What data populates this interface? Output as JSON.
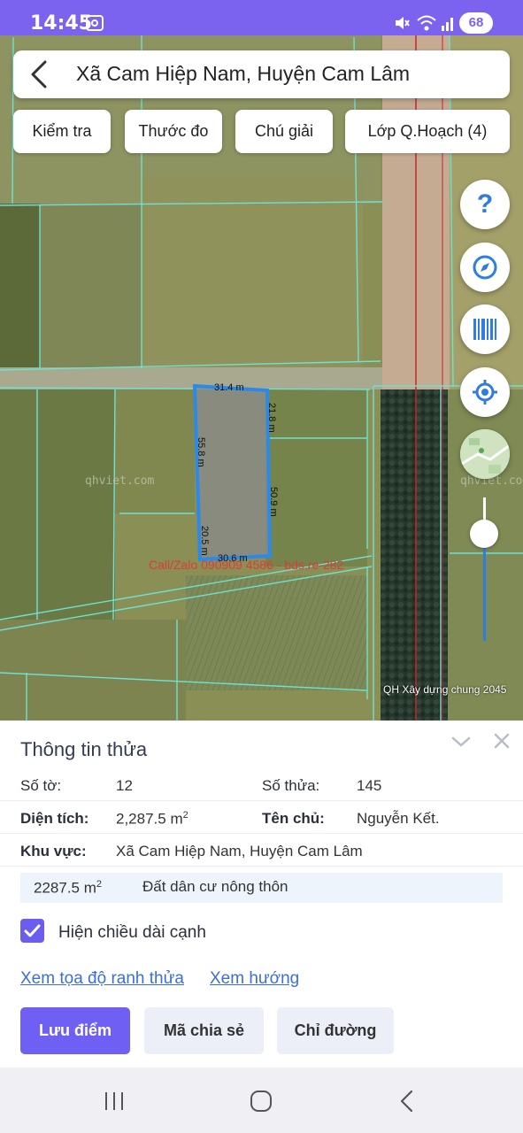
{
  "status_bar": {
    "time": "14:45",
    "battery": "68"
  },
  "header": {
    "title": "Xã Cam Hiệp Nam, Huyện Cam Lâm"
  },
  "chips": [
    "Kiểm tra",
    "Thước đo",
    "Chú giải",
    "Lớp Q.Hoạch (4)"
  ],
  "map": {
    "edge_labels": [
      "31.4 m",
      "21.8 m",
      "55.8 m",
      "50.9 m",
      "20.5 m",
      "30.6 m"
    ],
    "watermark": "qhviet.com",
    "watermark_right": "qhviet.co",
    "contact": "Call/Zalo 090909 4586 - bds.re-282",
    "layer_caption": "QH Xây dựng chung 2045",
    "zoom_level": 0.75,
    "colors": {
      "parcel": "#2b8ae8",
      "boundary": "#6fe0d2",
      "contact": "#e03a3a"
    }
  },
  "fab_icons": [
    "help-icon",
    "compass-icon",
    "barcode-icon",
    "locate-icon",
    "map-thumbnail"
  ],
  "panel": {
    "title": "Thông tin thửa",
    "so_to_label": "Số tờ:",
    "so_to_value": "12",
    "so_thua_label": "Số thửa:",
    "so_thua_value": "145",
    "dien_tich_label": "Diện tích:",
    "dien_tich_value": "2,287.5 m",
    "ten_chu_label": "Tên chủ:",
    "ten_chu_value": "Nguyễn Kết.",
    "khu_vuc_label": "Khu vực:",
    "khu_vuc_value": "Xã Cam Hiệp Nam, Huyện Cam Lâm",
    "land_area": "2287.5 m",
    "land_type": "Đất dân cư nông thôn",
    "unit_sup": "2",
    "checkbox_label": "Hiện chiều dài cạnh",
    "checkbox_checked": true,
    "link_coords": "Xem tọa độ ranh thửa",
    "link_direction": "Xem hướng",
    "btn_save": "Lưu điểm",
    "btn_share": "Mã chia sẻ",
    "btn_route": "Chỉ đường"
  }
}
